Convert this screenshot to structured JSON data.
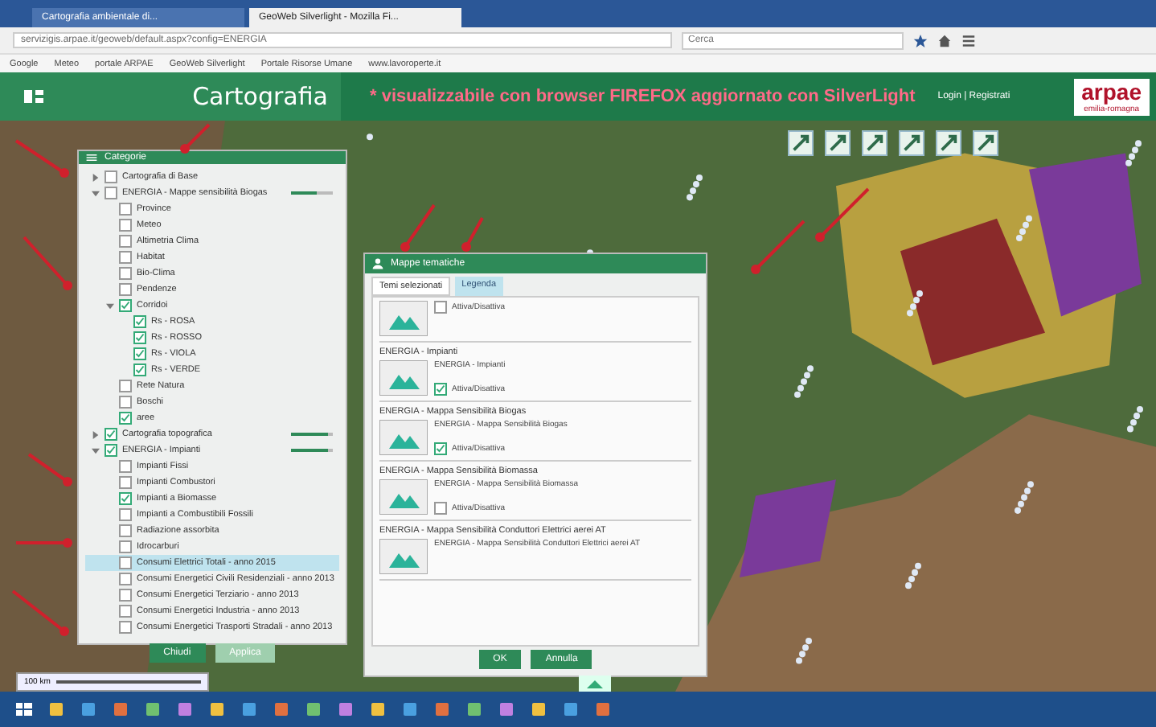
{
  "browser": {
    "tabs": [
      {
        "label": "Cartografia ambientale di...",
        "selected": false
      },
      {
        "label": "GeoWeb Silverlight - Mozilla Fi...",
        "selected": true
      }
    ],
    "address": "servizigis.arpae.it/geoweb/default.aspx?config=ENERGIA",
    "search_placeholder": "Cerca",
    "bookmarks": [
      "Google",
      "Meteo",
      "portale ARPAE",
      "GeoWeb Silverlight",
      "Portale Risorse Umane",
      "www.lavoroperte.it"
    ]
  },
  "header": {
    "title": "Cartografia",
    "notice": "* visualizzabile con browser FIREFOX aggiornato con SilverLight",
    "login": "Login | Registrati",
    "logo": "arpae",
    "logo_sub": "emilia-romagna"
  },
  "layers_panel": {
    "title": "Categorie",
    "items": [
      {
        "label": "Cartografia di Base",
        "checked": false,
        "expanded": false,
        "selected": false
      },
      {
        "label": "ENERGIA - Mappe sensibilità Biogas",
        "checked": false,
        "expanded": true,
        "selected": false,
        "level": 0.6,
        "children": [
          {
            "label": "Province",
            "checked": false,
            "selected": false
          },
          {
            "label": "Meteo",
            "checked": false,
            "selected": false
          },
          {
            "label": "Altimetria Clima",
            "checked": false,
            "selected": false
          },
          {
            "label": "Habitat",
            "checked": false,
            "selected": false
          },
          {
            "label": "Bio-Clima",
            "checked": false,
            "selected": false
          },
          {
            "label": "Pendenze",
            "checked": false,
            "selected": false
          },
          {
            "label": "Corridoi",
            "checked": true,
            "expanded": true,
            "selected": false,
            "children": [
              {
                "label": "Rs - ROSA",
                "checked": true,
                "selected": false
              },
              {
                "label": "Rs - ROSSO",
                "checked": true,
                "selected": false
              },
              {
                "label": "Rs - VIOLA",
                "checked": true,
                "selected": false
              },
              {
                "label": "Rs - VERDE",
                "checked": true,
                "selected": false
              }
            ]
          },
          {
            "label": "Rete Natura",
            "checked": false,
            "selected": false
          },
          {
            "label": "Boschi",
            "checked": false,
            "selected": false
          },
          {
            "label": "aree",
            "checked": true,
            "selected": false
          }
        ]
      },
      {
        "label": "Cartografia topografica",
        "checked": true,
        "expanded": false,
        "selected": false,
        "level": 0.9
      },
      {
        "label": "ENERGIA - Impianti",
        "checked": true,
        "expanded": true,
        "selected": false,
        "level": 0.9,
        "children": [
          {
            "label": "Impianti Fissi",
            "checked": false,
            "selected": false
          },
          {
            "label": "Impianti Combustori",
            "checked": false,
            "selected": false
          },
          {
            "label": "Impianti a Biomasse",
            "checked": true,
            "selected": false
          },
          {
            "label": "Impianti a Combustibili Fossili",
            "checked": false,
            "selected": false
          },
          {
            "label": "Radiazione assorbita",
            "checked": false,
            "selected": false
          },
          {
            "label": "Idrocarburi",
            "checked": false,
            "selected": false
          },
          {
            "label": "Consumi Elettrici Totali - anno 2015",
            "checked": false,
            "selected": true
          },
          {
            "label": "Consumi Energetici Civili Residenziali - anno 2013",
            "checked": false,
            "selected": false
          },
          {
            "label": "Consumi Energetici Terziario - anno 2013",
            "checked": false,
            "selected": false
          },
          {
            "label": "Consumi Energetici Industria - anno 2013",
            "checked": false,
            "selected": false
          },
          {
            "label": "Consumi Energetici Trasporti Stradali - anno 2013",
            "checked": false,
            "selected": false
          }
        ]
      }
    ],
    "buttons": [
      "Chiudi",
      "Applica"
    ]
  },
  "themes_panel": {
    "title": "Mappe tematiche",
    "tabs": [
      {
        "label": "Temi selezionati",
        "selected": true
      },
      {
        "label": "Legenda",
        "selected": false
      }
    ],
    "entries": [
      {
        "toggle": "Attiva/Disattiva",
        "checked": false
      },
      {
        "heading": "ENERGIA - Impianti",
        "name": "ENERGIA - Impianti",
        "toggle": "Attiva/Disattiva",
        "checked": true
      },
      {
        "heading": "ENERGIA - Mappa Sensibilità Biogas",
        "name": "ENERGIA - Mappa Sensibilità Biogas",
        "toggle": "Attiva/Disattiva",
        "checked": true
      },
      {
        "heading": "ENERGIA - Mappa Sensibilità Biomassa",
        "name": "ENERGIA - Mappa Sensibilità Biomassa",
        "toggle": "Attiva/Disattiva",
        "checked": false
      },
      {
        "heading": "ENERGIA - Mappa Sensibilità Conduttori Elettrici aerei AT",
        "name": "ENERGIA - Mappa Sensibilità Conduttori Elettrici aerei AT"
      }
    ],
    "buttons": [
      "OK",
      "Annulla"
    ]
  },
  "scale": "100 km"
}
